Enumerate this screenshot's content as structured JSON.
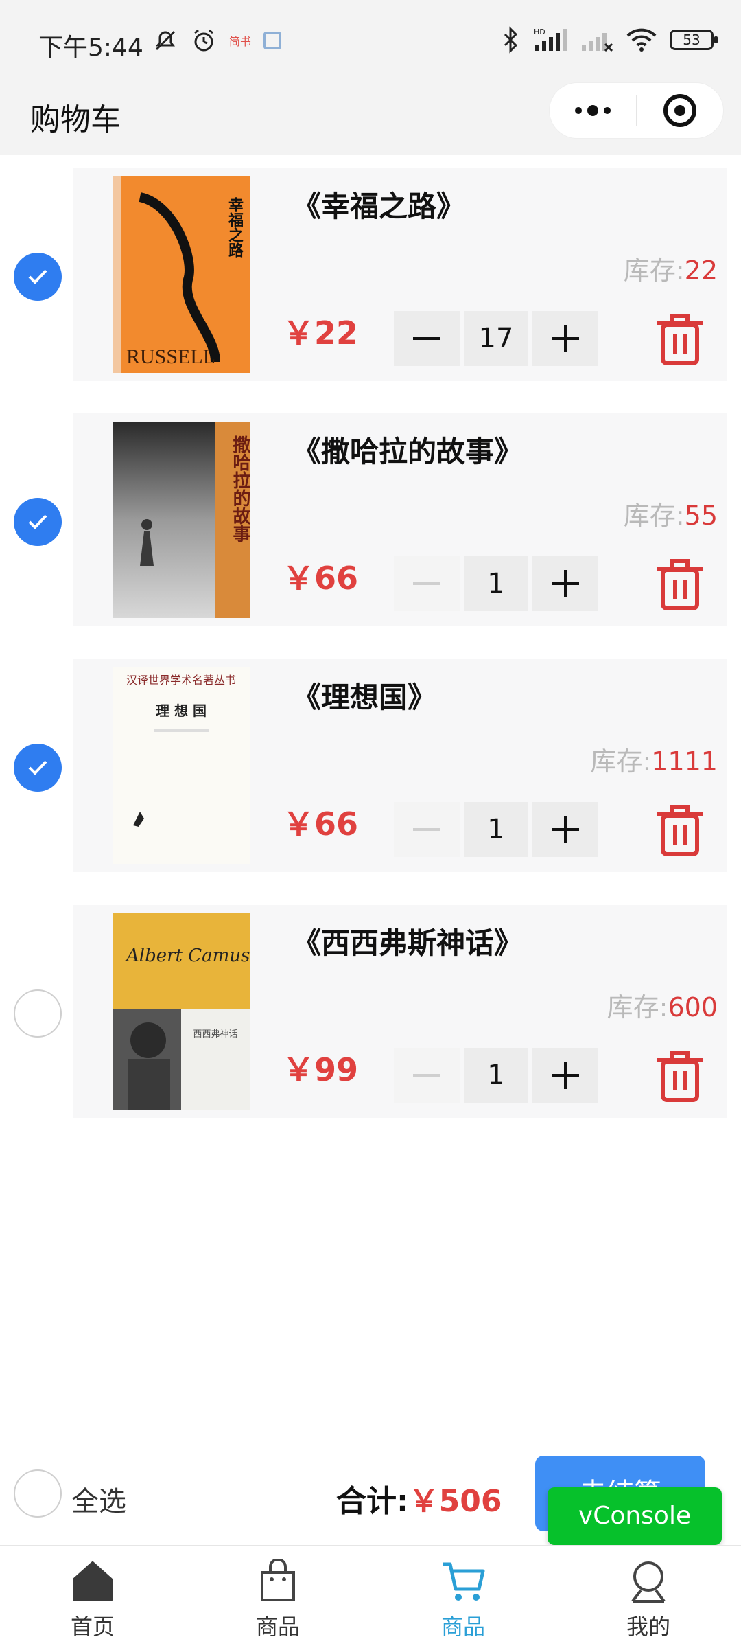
{
  "status_bar": {
    "time": "下午5:44",
    "mini_label": "简书",
    "battery": "53"
  },
  "header": {
    "title": "购物车"
  },
  "cart": {
    "items": [
      {
        "title": "《幸福之路》",
        "stock_label": "库存:",
        "stock": "22",
        "price": "￥22",
        "quantity": "17",
        "checked": true,
        "cover_spine": "幸福之路",
        "cover_author": "RUSSELL"
      },
      {
        "title": "《撒哈拉的故事》",
        "stock_label": "库存:",
        "stock": "55",
        "price": "￥66",
        "quantity": "1",
        "checked": true,
        "cover_spine": "撒哈拉的故事"
      },
      {
        "title": "《理想国》",
        "stock_label": "库存:",
        "stock": "1111",
        "price": "￥66",
        "quantity": "1",
        "checked": true,
        "cover_series": "汉译世界学术名著丛书",
        "cover_title": "理 想 国"
      },
      {
        "title": "《西西弗斯神话》",
        "stock_label": "库存:",
        "stock": "600",
        "price": "￥99",
        "quantity": "1",
        "checked": false,
        "cover_signature": "Albert Camus",
        "cover_title": "西西弗神话"
      }
    ]
  },
  "footer": {
    "select_all": "全选",
    "total_label": "合计:",
    "total_amount": "￥506",
    "settle_button": "去结算"
  },
  "vconsole": "vConsole",
  "tabbar": {
    "tabs": [
      {
        "label": "首页"
      },
      {
        "label": "商品"
      },
      {
        "label": "商品"
      },
      {
        "label": "我的"
      }
    ],
    "active_index": 2
  },
  "colors": {
    "accent_blue": "#2f7df0",
    "price_red": "#e0413f",
    "tab_active": "#2a9fd6",
    "vconsole_green": "#06c12b"
  }
}
